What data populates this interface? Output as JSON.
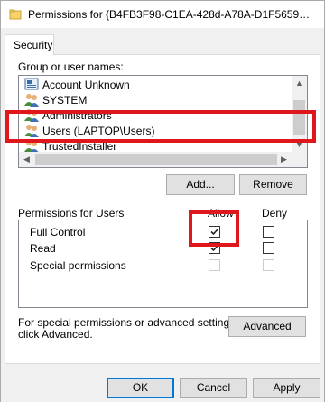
{
  "window": {
    "title": "Permissions for {B4FB3F98-C1EA-428d-A78A-D1F5659…"
  },
  "tabs": [
    {
      "label": "Security"
    }
  ],
  "group_section": {
    "label": "Group or user names:",
    "items": [
      {
        "label": "Account Unknown",
        "icon": "account-unknown-icon"
      },
      {
        "label": "SYSTEM",
        "icon": "users-icon"
      },
      {
        "label": "Administrators",
        "icon": "users-icon"
      },
      {
        "label": "Users (LAPTOP\\Users)",
        "icon": "users-icon",
        "selected": true
      },
      {
        "label": "TrustedInstaller",
        "icon": "users-icon"
      }
    ]
  },
  "buttons": {
    "add": "Add...",
    "remove": "Remove",
    "advanced": "Advanced",
    "ok": "OK",
    "cancel": "Cancel",
    "apply": "Apply"
  },
  "permissions": {
    "label": "Permissions for Users",
    "allow_header": "Allow",
    "deny_header": "Deny",
    "rows": [
      {
        "label": "Full Control",
        "allow": true,
        "deny": false,
        "enabled": true
      },
      {
        "label": "Read",
        "allow": true,
        "deny": false,
        "enabled": true
      },
      {
        "label": "Special permissions",
        "allow": false,
        "deny": false,
        "enabled": false
      }
    ]
  },
  "advanced_text": {
    "line1": "For special permissions or advanced settings,",
    "line2": "click Advanced."
  },
  "colors": {
    "highlight": "#e0161d",
    "accent": "#0078d7"
  }
}
